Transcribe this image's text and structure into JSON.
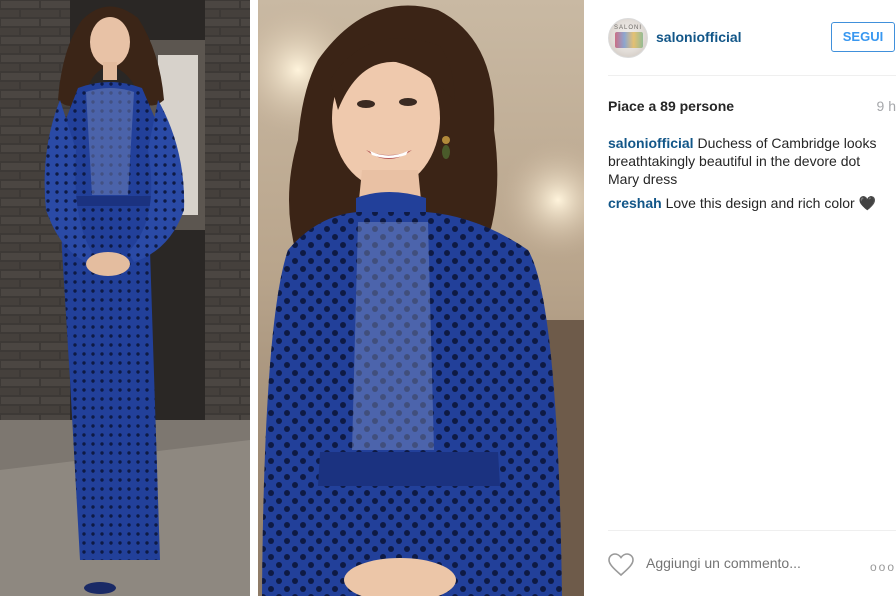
{
  "post": {
    "image_alt": "",
    "panels": [
      "left",
      "right"
    ]
  },
  "header": {
    "avatar_icon": "salon-logo-avatar",
    "avatar_text": "SALONI",
    "username": "saloniofficial",
    "follow_label": "SEGUI"
  },
  "meta": {
    "likes": "Piace a 89 persone",
    "time": "9 h"
  },
  "comments": [
    {
      "author": "saloniofficial",
      "text": " Duchess of Cambridge looks breathtakingly beautiful in the devore dot Mary dress"
    },
    {
      "author": "creshah",
      "text": " Love this design and rich color 🖤"
    }
  ],
  "footer": {
    "like_icon": "heart-icon",
    "comment_placeholder": "Aggiungi un commento...",
    "more_icon": "more-options-icon",
    "more_label": "ooo"
  },
  "colors": {
    "link": "#125688",
    "follow": "#3897f0",
    "dress": "#22409a",
    "dots": "#0e1a44"
  }
}
